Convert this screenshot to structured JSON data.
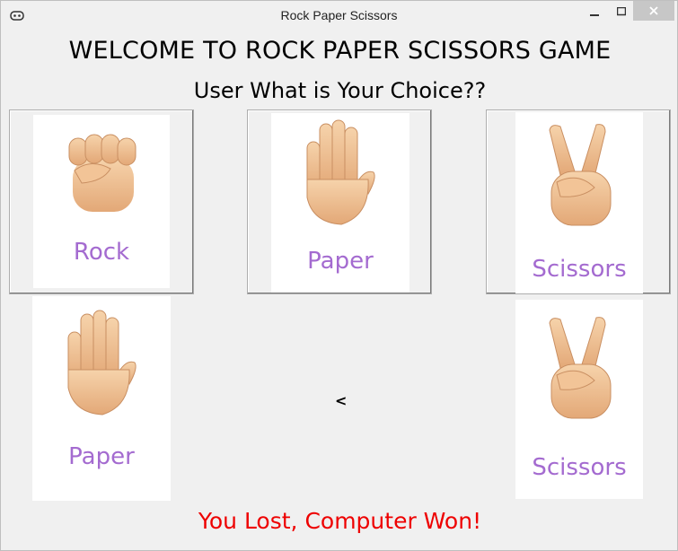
{
  "window": {
    "title": "Rock Paper Scissors"
  },
  "header": {
    "welcome": "WELCOME TO ROCK PAPER SCISSORS GAME",
    "prompt": "User What is Your Choice??"
  },
  "choices": [
    {
      "label": "Rock",
      "icon": "fist-emoji-icon"
    },
    {
      "label": "Paper",
      "icon": "raised-hand-emoji-icon"
    },
    {
      "label": "Scissors",
      "icon": "victory-hand-emoji-icon"
    }
  ],
  "user_pick": {
    "label": "Paper",
    "icon": "raised-hand-emoji-icon"
  },
  "computer_pick": {
    "label": "Scissors",
    "icon": "victory-hand-emoji-icon"
  },
  "vs_symbol": "<",
  "result": "You Lost, Computer Won!",
  "colors": {
    "label_purple": "#a46bd0",
    "result_red": "#ee0000",
    "skin": "#f2c79a"
  }
}
